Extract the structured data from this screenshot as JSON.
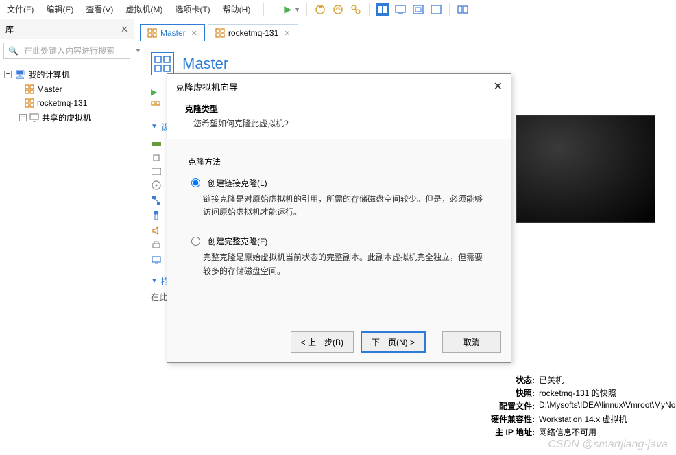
{
  "menu": {
    "file": "文件(F)",
    "edit": "编辑(E)",
    "view": "查看(V)",
    "vm": "虚拟机(M)",
    "tabs": "选项卡(T)",
    "help": "帮助(H)"
  },
  "sidebar": {
    "title": "库",
    "search_placeholder": "在此处键入内容进行搜索",
    "my_computer": "我的计算机",
    "nodes": [
      "Master",
      "rocketmq-131"
    ],
    "shared": "共享的虚拟机"
  },
  "tabs_area": {
    "items": [
      "Master",
      "rocketmq-131"
    ]
  },
  "vm": {
    "title": "Master"
  },
  "section": {
    "devices": "设",
    "desc_label": "描述",
    "desc_text": "在此"
  },
  "dialog": {
    "title": "克隆虚拟机向导",
    "subtitle": "克隆类型",
    "subdesc": "您希望如何克隆此虚拟机?",
    "method_label": "克隆方法",
    "opt1_label": "创建链接克隆(L)",
    "opt1_desc": "链接克隆是对原始虚拟机的引用，所需的存储磁盘空间较少。但是，必须能够访问原始虚拟机才能运行。",
    "opt2_label": "创建完整克隆(F)",
    "opt2_desc": "完整克隆是原始虚拟机当前状态的完整副本。此副本虚拟机完全独立，但需要较多的存储磁盘空间。",
    "btn_back": "< 上一步(B)",
    "btn_next": "下一页(N) >",
    "btn_cancel": "取消"
  },
  "details": {
    "state_label": "状态:",
    "state_value": "已关机",
    "snapshot_label": "快照:",
    "snapshot_value": "rocketmq-131 的快照",
    "config_label": "配置文件:",
    "config_value": "D:\\Mysofts\\IDEA\\linnux\\Vmroot\\MyNode.vmx",
    "compat_label": "硬件兼容性:",
    "compat_value": "Workstation 14.x 虚拟机",
    "ip_label": "主 IP 地址:",
    "ip_value": "网络信息不可用"
  },
  "watermark": "CSDN @smartjiang-java"
}
